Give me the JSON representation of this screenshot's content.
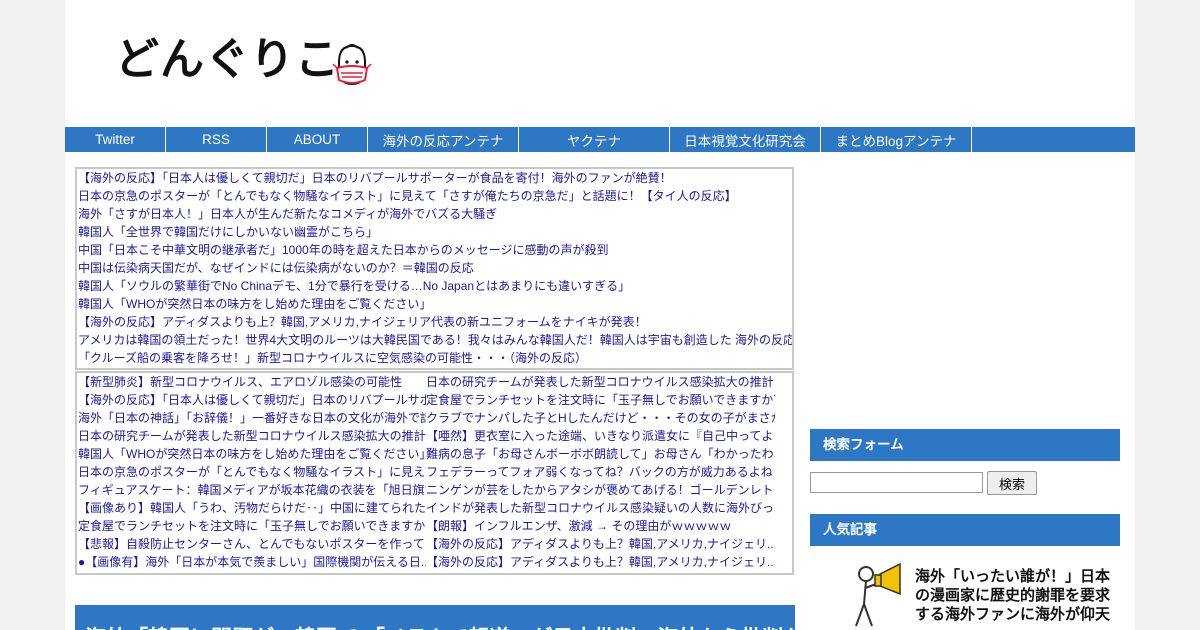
{
  "site": {
    "logo_text": "どんぐりこ"
  },
  "nav": {
    "items": [
      {
        "label": "Twitter"
      },
      {
        "label": "RSS"
      },
      {
        "label": "ABOUT"
      },
      {
        "label": "海外の反応アンテナ"
      },
      {
        "label": "ヤクテナ"
      },
      {
        "label": "日本視覚文化研究会"
      },
      {
        "label": "まとめBlogアンテナ"
      }
    ]
  },
  "antenna1": {
    "items": [
      "【海外の反応】「日本人は優しくて親切だ」日本のリバプールサポーターが食品を寄付！海外のファンが絶賛！",
      "日本の京急のポスターが「とんでもなく物騒なイラスト」に見えて「さすが俺たちの京急だ」と話題に！【タイ人の反応】",
      "海外「さすが日本人！」日本人が生んだ新たなコメディが海外でバズる大騒ぎ",
      "韓国人「全世界で韓国だけにしかいない幽霊がこちら」",
      "中国「日本こそ中華文明の継承者だ」1000年の時を超えた日本からのメッセージに感動の声が殺到",
      "中国は伝染病天国だが、なぜインドには伝染病がないのか？＝韓国の反応",
      "韓国人「ソウルの繁華街でNo Chinaデモ、1分で暴行を受ける…No Japanとはあまりにも違いすぎる」",
      "韓国人「WHOが突然日本の味方をし始めた理由をご覧ください」",
      "【海外の反応】アディダスよりも上？韓国,アメリカ,ナイジェリア代表の新ユニフォームをナイキが発表！",
      "アメリカは韓国の領土だった！世界4大文明のルーツは大韓民国である！我々はみんな韓国人だ！韓国人は宇宙も創造した 海外の反応",
      "「クルーズ船の乗客を降ろせ！」新型コロナウイルスに空気感染の可能性・・・（海外の反応）"
    ]
  },
  "antenna2": {
    "left": [
      "【新型肺炎】新型コロナウイルス、エアロゾル感染の可能性",
      "【海外の反応】「日本人は優しくて親切だ」日本のリバプールサポ",
      "海外「日本の神話」「お辞儀！」一番好きな日本の文化が海外で話",
      "日本の研究チームが発表した新型コロナウイルス感染拡大の推計に",
      "韓国人「WHOが突然日本の味方をし始めた理由をご覧ください」",
      "日本の京急のポスターが「とんでもなく物騒なイラスト」に見えて",
      "フィギュアスケート：韓国メディアが坂本花織の衣装を「旭日旗だ",
      "【画像あり】韓国人「うわ、汚物だらけだ‥」中国に建てられた武",
      "定食屋でランチセットを注文時に「玉子無しでお願いできますか？",
      "【悲報】自殺防止センターさん、とんでもないポスターを作ってし",
      "【画像有】海外「日本が本気で羨ましい」国際機関が伝える日..."
    ],
    "right": [
      "日本の研究チームが発表した新型コロナウイルス感染拡大の推計に",
      "定食屋でランチセットを注文時に「玉子無しでお願いできますか？",
      "クラブでナンパした子とHしたんだけど・・・その女の子がまさか.",
      "【唖然】更衣室に入った途端、いきなり派遣女に『自己中ってよく",
      "難病の息子「お母さんボーボボ朗読して」お母さん「わかったわよ",
      "フェデラーってフォア弱くなってね？バックの方が威力あるよね･.",
      "ニンゲンが芸をしたからアタシが褒めてあげる！ゴールデンレトリ",
      "インドが発表した新型コロナウイルス感染疑いの人数に海外びっく",
      "【朗報】インフルエンザ、激減 → その理由がｗｗｗｗｗ",
      "【海外の反応】アディダスよりも上？韓国,アメリカ,ナイジェリ...",
      "【海外の反応】アディダスよりも上？韓国,アメリカ,ナイジェリ..."
    ],
    "bullet": "●"
  },
  "article": {
    "title": "海外「韓国に問題が」韓国で 「メラムで報道」が日本批判…海外から批判が殺"
  },
  "sidebar": {
    "search_title": "検索フォーム",
    "search_value": "",
    "search_button": "検索",
    "popular_title": "人気記事",
    "popular_item": "海外「いったい誰が！」日本の漫画家に歴史的謝罪を要求する海外ファンに海外が仰天"
  },
  "colors": {
    "accent": "#2e77c4",
    "link": "#1a1a9e"
  }
}
